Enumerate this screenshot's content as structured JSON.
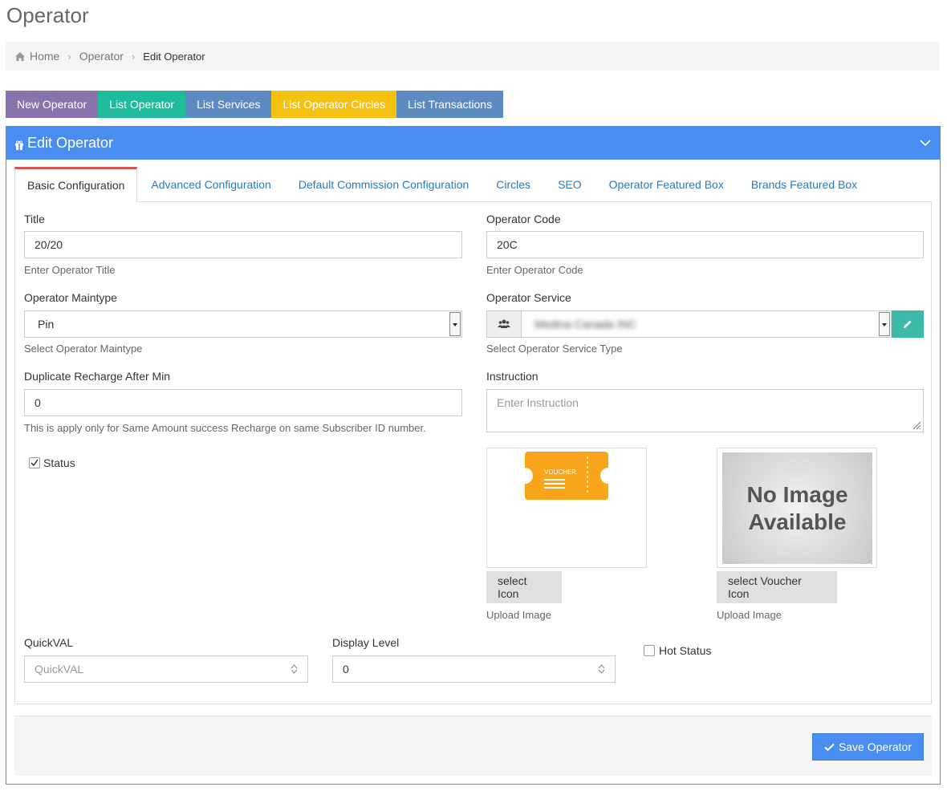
{
  "page": {
    "title": "Operator"
  },
  "breadcrumb": {
    "home": "Home",
    "operator": "Operator",
    "current": "Edit Operator"
  },
  "nav_buttons": [
    {
      "label": "New Operator",
      "color": "#8a73ac"
    },
    {
      "label": "List Operator",
      "color": "#1fbc9c"
    },
    {
      "label": "List Services",
      "color": "#5b8bc0"
    },
    {
      "label": "List Operator Circles",
      "color": "#f5c211"
    },
    {
      "label": "List Transactions",
      "color": "#5b8bc0"
    }
  ],
  "panel": {
    "title": "Edit Operator",
    "header_color": "#4a8df0"
  },
  "tabs": [
    {
      "label": "Basic Configuration",
      "active": true
    },
    {
      "label": "Advanced Configuration"
    },
    {
      "label": "Default Commission Configuration"
    },
    {
      "label": "Circles"
    },
    {
      "label": "SEO"
    },
    {
      "label": "Operator Featured Box"
    },
    {
      "label": "Brands Featured Box"
    }
  ],
  "form": {
    "title": {
      "label": "Title",
      "value": "20/20",
      "help": "Enter Operator Title"
    },
    "operator_code": {
      "label": "Operator Code",
      "value": "20C",
      "help": "Enter Operator Code"
    },
    "maintype": {
      "label": "Operator Maintype",
      "value": "Pin",
      "help": "Select Operator Maintype"
    },
    "service": {
      "label": "Operator Service",
      "value": "Medina Canada INC",
      "help": "Select Operator Service Type"
    },
    "duplicate": {
      "label": "Duplicate Recharge After Min",
      "value": "0",
      "help": "This is apply only for Same Amount success Recharge on same Subscriber ID number."
    },
    "instruction": {
      "label": "Instruction",
      "placeholder": "Enter Instruction"
    },
    "status": {
      "label": "Status",
      "checked": true
    },
    "icon": {
      "button": "select Icon",
      "help": "Upload Image",
      "image_text": "VOUCHER",
      "image_color": "#f8a51b"
    },
    "voucher_icon": {
      "button": "select Voucher Icon",
      "help": "Upload Image",
      "image_line1": "No Image",
      "image_line2": "Available"
    },
    "quickval": {
      "label": "QuickVAL",
      "placeholder": "QuickVAL"
    },
    "display_level": {
      "label": "Display Level",
      "value": "0"
    },
    "hot_status": {
      "label": "Hot Status",
      "checked": false
    }
  },
  "save": {
    "label": "Save Operator"
  }
}
